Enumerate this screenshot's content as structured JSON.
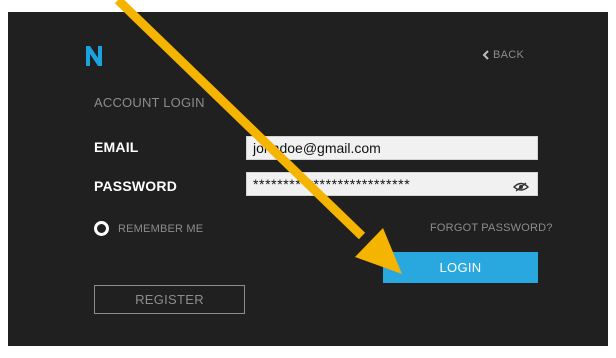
{
  "app": {
    "logo_icon": "n-logo-icon",
    "brand_color": "#1ba3e0"
  },
  "nav": {
    "back_label": "BACK",
    "back_icon": "chevron-left-icon"
  },
  "form": {
    "heading": "ACCOUNT LOGIN",
    "email_label": "EMAIL",
    "email_value": "johndoe@gmail.com",
    "password_label": "PASSWORD",
    "password_value": "**************************",
    "password_toggle_icon": "eye-slash-icon",
    "remember_label": "REMEMBER ME",
    "forgot_label": "FORGOT PASSWORD?",
    "login_label": "LOGIN",
    "register_label": "REGISTER"
  },
  "overlay": {
    "annotation_icon": "arrow-annotation-icon",
    "color": "#f5b400"
  },
  "colors": {
    "background": "#202020",
    "muted_text": "#8c8c8c",
    "login_button": "#29a8e0"
  }
}
